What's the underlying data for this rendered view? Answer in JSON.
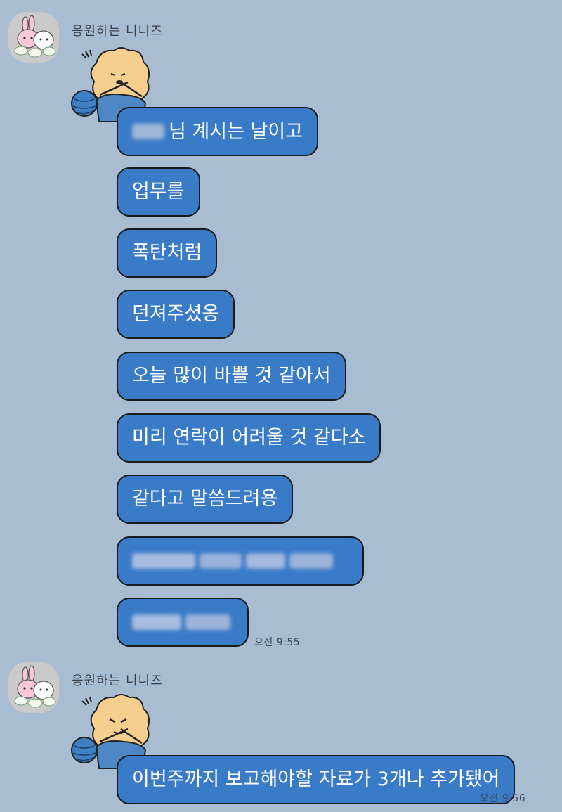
{
  "chat": {
    "groups": [
      {
        "sender": "응원하는 니니즈",
        "messages": [
          {
            "text": "님 계시는 날이고",
            "redacted_prefix": true
          },
          {
            "text": "업무를"
          },
          {
            "text": "폭탄처럼"
          },
          {
            "text": "던져주셨옹"
          },
          {
            "text": "오늘 많이 바쁠 것 같아서"
          },
          {
            "text": "미리 연락이 어려울 것 같다소"
          },
          {
            "text": "같다고 말씀드려용"
          },
          {
            "text": "",
            "redacted": true
          },
          {
            "text": "",
            "redacted": true
          }
        ],
        "time": "오전 9:55"
      },
      {
        "sender": "응원하는 니니즈",
        "messages": [
          {
            "text": "이번주까지 보고해야할 자료가 3개나 추가됐어"
          }
        ],
        "time": "오전 9:56"
      }
    ]
  },
  "colors": {
    "background": "#a9bdd2",
    "bubble": "#3a7bc8",
    "bubble_border": "#1a1a1a",
    "text": "#ffffff"
  },
  "icons": {
    "avatar": "ninis-friends-avatar",
    "sticker": "knitting-bear-sticker"
  }
}
